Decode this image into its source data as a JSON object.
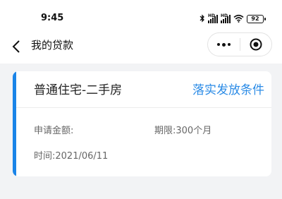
{
  "status_bar": {
    "time": "9:45",
    "battery": "92",
    "signal_label_1": "HD",
    "signal_label_2": "HD",
    "icons": [
      "bluetooth-icon",
      "signal-icon",
      "signal-icon",
      "wifi-icon",
      "battery-icon"
    ]
  },
  "nav": {
    "title": "我的贷款",
    "back_icon": "chevron-left-icon",
    "more_icon": "more-dots-icon",
    "close_icon": "target-circle-icon"
  },
  "loan_card": {
    "title": "普通住宅-二手房",
    "condition_link": "落实发放条件",
    "amount_label": "申请金额:",
    "amount_value": "",
    "term_label": "期限:",
    "term_value": "300个月",
    "time_label": "时间:",
    "time_value": "2021/06/11"
  },
  "colors": {
    "accent": "#1a84e8",
    "link": "#2b8be6",
    "background": "#f2f3f5"
  }
}
